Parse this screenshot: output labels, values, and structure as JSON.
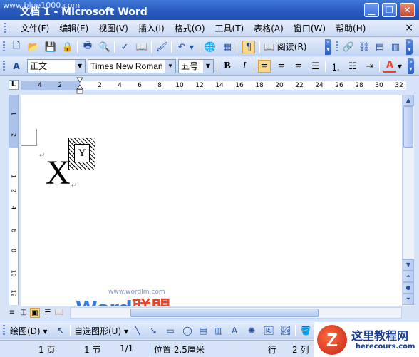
{
  "titlebar": {
    "watermark_site": "www.blue1000.com",
    "title": "文档 1 - Microsoft Word"
  },
  "menubar": {
    "items": [
      "文件(F)",
      "编辑(E)",
      "视图(V)",
      "插入(I)",
      "格式(O)",
      "工具(T)",
      "表格(A)",
      "窗口(W)",
      "帮助(H)"
    ],
    "close_glyph": "×"
  },
  "toolbar_standard": {
    "read_label": "阅读(R)"
  },
  "toolbar_format": {
    "style_value": "正文",
    "font_value": "Times New Roman",
    "size_value": "五号",
    "bold": "B",
    "italic": "I"
  },
  "ruler": {
    "corner": "L",
    "ticks": [
      "4",
      "2",
      "",
      "2",
      "4",
      "6",
      "8",
      "10",
      "12",
      "14",
      "16",
      "18",
      "20",
      "22",
      "24",
      "26",
      "28",
      "30",
      "32"
    ],
    "vticks": [
      "1",
      "",
      "2",
      "",
      "1",
      "2",
      "4",
      "6",
      "8",
      "10",
      "12"
    ]
  },
  "document": {
    "big_char": "X",
    "box_char": "Y",
    "watermark_site": "www.wordlm.com",
    "watermark_word": "Word",
    "watermark_cn": "联盟"
  },
  "drawbar": {
    "draw_label": "绘图(D)",
    "autoshape_label": "自选图形(U)"
  },
  "statusbar": {
    "page": "1 页",
    "section": "1 节",
    "page_of": "1/1",
    "position": "位置 2.5厘米",
    "line": "行",
    "col": "2 列"
  },
  "logo": {
    "letter": "Z",
    "cn": "这里教程网",
    "en": "herecours.com"
  },
  "colors": {
    "title_blue": "#2a5bbd",
    "toolbar_bg": "#c9d9f4",
    "accent_orange": "#fbd98e",
    "font_color_red": "#e8462b"
  }
}
